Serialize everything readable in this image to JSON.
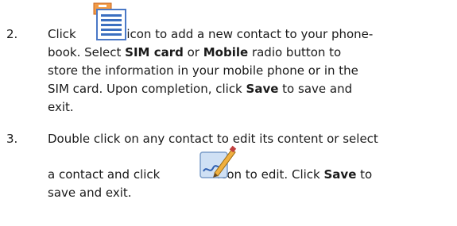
{
  "steps": [
    {
      "number": "2.",
      "icon": "new-contact-document-icon",
      "lines": [
        {
          "before": "Click",
          "after": "icon to add a new contact to your phone-"
        },
        {
          "t1": "book. Select ",
          "b1": "SIM card",
          "t2": " or ",
          "b2": "Mobile",
          "t3": " radio button to"
        },
        {
          "text": "store the information in your mobile phone or in the"
        },
        {
          "t1": "SIM card. Upon completion, click ",
          "b1": "Save",
          "t2": " to save and"
        },
        {
          "text": "exit."
        }
      ]
    },
    {
      "number": "3.",
      "icon": "edit-pen-icon",
      "lines": [
        {
          "text": "Double click on any contact to edit its content or select"
        },
        {
          "before": "a contact and click",
          "after": "icon to edit. Click ",
          "b1": "Save",
          "t2": " to"
        },
        {
          "text": "save and exit."
        }
      ]
    }
  ],
  "colors": {
    "text": "#1a1a1a",
    "icon_blue": "#3b6fc0",
    "icon_orange": "#e07a2a"
  }
}
